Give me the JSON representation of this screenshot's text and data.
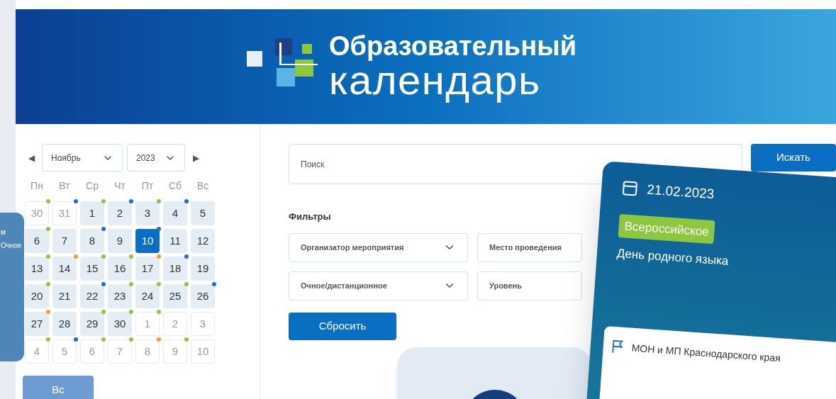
{
  "header": {
    "title_line1": "Образовательный",
    "title_line2": "календарь"
  },
  "calendar": {
    "prev": "◀",
    "next": "▶",
    "month": "Ноябрь",
    "year": "2023",
    "weekdays": [
      "Пн",
      "Вт",
      "Ср",
      "Чт",
      "Пт",
      "Сб",
      "Вс"
    ],
    "days": [
      {
        "label": "30",
        "in_month": false,
        "selected": false,
        "color": "#8dc63f"
      },
      {
        "label": "31",
        "in_month": false,
        "selected": false,
        "color": "#1e6fd1"
      },
      {
        "label": "1",
        "in_month": true,
        "selected": false,
        "color": "#8dc63f"
      },
      {
        "label": "2",
        "in_month": true,
        "selected": false,
        "color": "#1e6fd1"
      },
      {
        "label": "3",
        "in_month": true,
        "selected": false,
        "color": "#8dc63f"
      },
      {
        "label": "4",
        "in_month": true,
        "selected": false,
        "color": "#1e6fd1"
      },
      {
        "label": "5",
        "in_month": true,
        "selected": false
      },
      {
        "label": "6",
        "in_month": true,
        "selected": false,
        "color": "#8dc63f"
      },
      {
        "label": "7",
        "in_month": true,
        "selected": false
      },
      {
        "label": "8",
        "in_month": true,
        "selected": false,
        "color": "#1e6fd1"
      },
      {
        "label": "9",
        "in_month": true,
        "selected": false
      },
      {
        "label": "10",
        "in_month": true,
        "selected": true,
        "color": "#1e6fd1"
      },
      {
        "label": "11",
        "in_month": true,
        "selected": false
      },
      {
        "label": "12",
        "in_month": true,
        "selected": false
      },
      {
        "label": "13",
        "in_month": true,
        "selected": false,
        "color": "#8dc63f"
      },
      {
        "label": "14",
        "in_month": true,
        "selected": false,
        "color": "#f39c3c"
      },
      {
        "label": "15",
        "in_month": true,
        "selected": false,
        "color": "#8dc63f"
      },
      {
        "label": "16",
        "in_month": true,
        "selected": false,
        "color": "#8dc63f"
      },
      {
        "label": "17",
        "in_month": true,
        "selected": false,
        "color": "#f39c3c"
      },
      {
        "label": "18",
        "in_month": true,
        "selected": false,
        "color": "#1e6fd1"
      },
      {
        "label": "19",
        "in_month": true,
        "selected": false
      },
      {
        "label": "20",
        "in_month": true,
        "selected": false,
        "color": "#8dc63f"
      },
      {
        "label": "21",
        "in_month": true,
        "selected": false
      },
      {
        "label": "22",
        "in_month": true,
        "selected": false,
        "color": "#1e6fd1"
      },
      {
        "label": "23",
        "in_month": true,
        "selected": false,
        "color": "#8dc63f"
      },
      {
        "label": "24",
        "in_month": true,
        "selected": false,
        "color": "#8dc63f"
      },
      {
        "label": "25",
        "in_month": true,
        "selected": false,
        "color": "#8dc63f"
      },
      {
        "label": "26",
        "in_month": true,
        "selected": false,
        "color": "#1e6fd1"
      },
      {
        "label": "27",
        "in_month": true,
        "selected": false,
        "color": "#f39c3c"
      },
      {
        "label": "28",
        "in_month": true,
        "selected": false
      },
      {
        "label": "29",
        "in_month": true,
        "selected": false,
        "color": "#8dc63f"
      },
      {
        "label": "30",
        "in_month": true,
        "selected": false,
        "color": "#8dc63f"
      },
      {
        "label": "1",
        "in_month": false,
        "selected": false,
        "color": "#8dc63f"
      },
      {
        "label": "2",
        "in_month": false,
        "selected": false
      },
      {
        "label": "3",
        "in_month": false,
        "selected": false
      },
      {
        "label": "4",
        "in_month": false,
        "selected": false,
        "color": "#8dc63f"
      },
      {
        "label": "5",
        "in_month": false,
        "selected": false,
        "color": "#1e6fd1"
      },
      {
        "label": "6",
        "in_month": false,
        "selected": false,
        "color": "#8dc63f"
      },
      {
        "label": "7",
        "in_month": false,
        "selected": false,
        "color": "#8dc63f"
      },
      {
        "label": "8",
        "in_month": false,
        "selected": false,
        "color": "#f39c3c"
      },
      {
        "label": "9",
        "in_month": false,
        "selected": false,
        "color": "#8dc63f"
      },
      {
        "label": "10",
        "in_month": false,
        "selected": false
      }
    ]
  },
  "search": {
    "placeholder": "Поиск",
    "button": "Искать"
  },
  "filters": {
    "title": "Фильтры",
    "selects": [
      {
        "label": "Организатор мероприятия",
        "kind": "dropdown"
      },
      {
        "label": "Место проведения",
        "kind": "field"
      },
      {
        "label": "Очное/дистанционное",
        "kind": "dropdown"
      },
      {
        "label": "Уровень",
        "kind": "field"
      }
    ],
    "reset": "Сбросить"
  },
  "event_card": {
    "date": "21.02.2023",
    "level": "Всероссийское",
    "title": "День родного языка",
    "organizer": "МОН и МП Краснодарского края"
  },
  "side_card": {
    "tabs": [
      "м",
      "Очное"
    ],
    "button": "Вс"
  }
}
